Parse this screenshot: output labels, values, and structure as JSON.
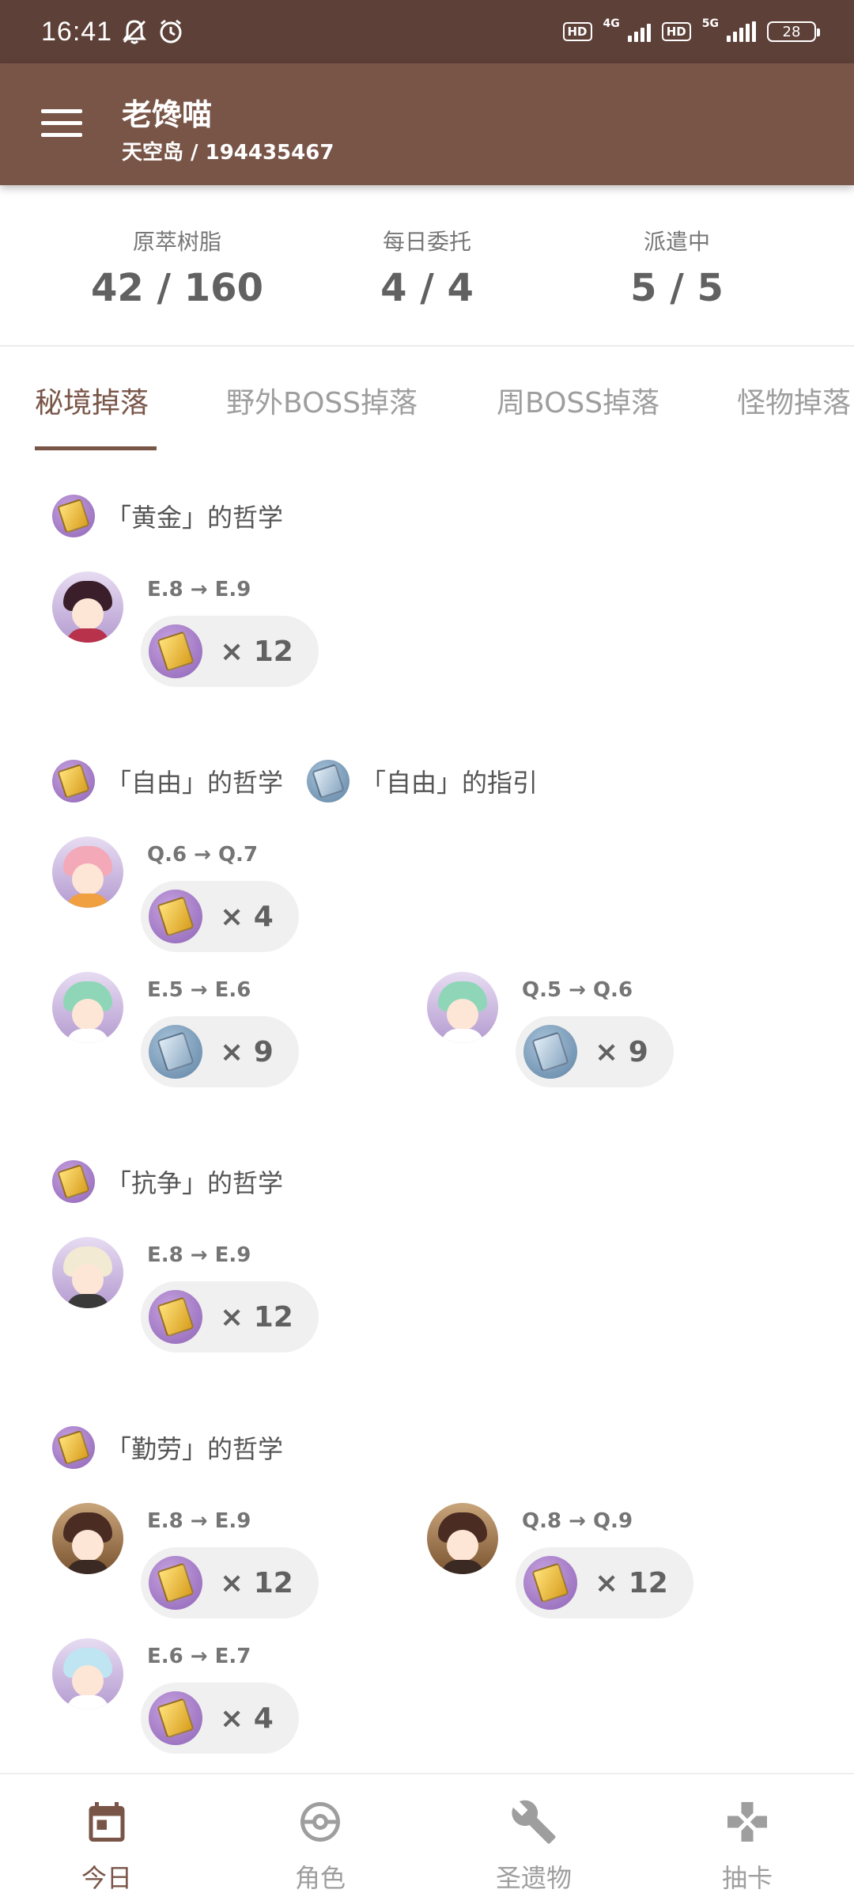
{
  "status_bar": {
    "time": "16:41",
    "hd1": "HD",
    "net1": "4G",
    "hd2": "HD",
    "net2": "5G",
    "battery": "28"
  },
  "app_bar": {
    "title": "老馋喵",
    "subtitle": "天空岛 / 194435467"
  },
  "stats": [
    {
      "label": "原萃树脂",
      "value": "42 / 160"
    },
    {
      "label": "每日委托",
      "value": "4 / 4"
    },
    {
      "label": "派遣中",
      "value": "5 / 5"
    }
  ],
  "tabs": [
    "秘境掉落",
    "野外BOSS掉落",
    "周BOSS掉落",
    "怪物掉落"
  ],
  "active_tab": 0,
  "groups": [
    {
      "materials": [
        {
          "name": "「黄金」的哲学",
          "kind": "gold"
        }
      ],
      "entries": [
        {
          "talent": "E.8 → E.9",
          "count": "× 12",
          "material": "gold"
        }
      ]
    },
    {
      "materials": [
        {
          "name": "「自由」的哲学",
          "kind": "gold"
        },
        {
          "name": "「自由」的指引",
          "kind": "blue"
        }
      ],
      "entries": [
        {
          "talent": "Q.6 → Q.7",
          "count": "× 4",
          "material": "gold"
        },
        {
          "talent": "E.5 → E.6",
          "count": "× 9",
          "material": "blue"
        },
        {
          "talent": "Q.5 → Q.6",
          "count": "× 9",
          "material": "blue"
        }
      ]
    },
    {
      "materials": [
        {
          "name": "「抗争」的哲学",
          "kind": "gold"
        }
      ],
      "entries": [
        {
          "talent": "E.8 → E.9",
          "count": "× 12",
          "material": "gold"
        }
      ]
    },
    {
      "materials": [
        {
          "name": "「勤劳」的哲学",
          "kind": "gold"
        }
      ],
      "entries": [
        {
          "talent": "E.8 → E.9",
          "count": "× 12",
          "material": "gold"
        },
        {
          "talent": "Q.8 → Q.9",
          "count": "× 12",
          "material": "gold"
        },
        {
          "talent": "E.6 → E.7",
          "count": "× 4",
          "material": "gold"
        }
      ]
    }
  ],
  "bottom_nav": [
    {
      "label": "今日",
      "icon": "calendar-icon"
    },
    {
      "label": "角色",
      "icon": "pokeball-icon"
    },
    {
      "label": "圣遗物",
      "icon": "wrench-icon"
    },
    {
      "label": "抽卡",
      "icon": "gamepad-icon"
    }
  ],
  "active_nav": 0,
  "colors": {
    "status_bar": "#5d4037",
    "app_bar": "#795548",
    "accent": "#795548",
    "inactive": "#9e9e9e",
    "pill_bg": "#f0f0f0"
  }
}
